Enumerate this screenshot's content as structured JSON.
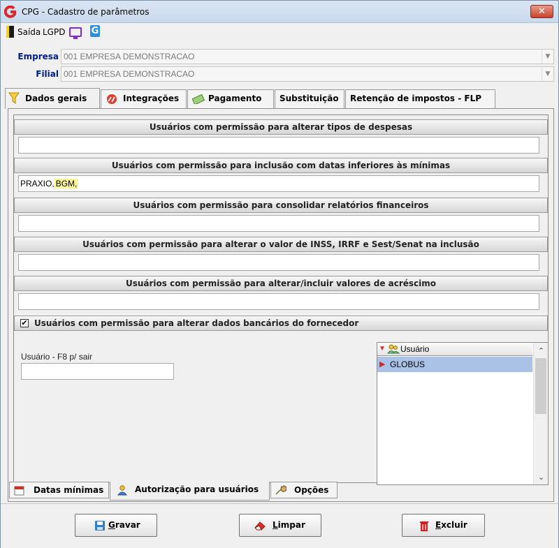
{
  "window": {
    "title": "CPG - Cadastro de parâmetros",
    "close_label": "✕"
  },
  "toolbar": {
    "exit_label": "Saída",
    "lgpd_label": "LGPD",
    "g_label": "G"
  },
  "fields": {
    "empresa_label": "Empresa",
    "empresa_value": "001 EMPRESA DEMONSTRACAO",
    "filial_label": "Filial",
    "filial_value": "001 EMPRESA DEMONSTRACAO"
  },
  "tabs": [
    {
      "label": "Dados gerais",
      "icon": "filter-icon"
    },
    {
      "label": "Integrações",
      "icon": "integration-icon"
    },
    {
      "label": "Pagamento",
      "icon": "money-icon"
    },
    {
      "label": "Substituição"
    },
    {
      "label": "Retenção de impostos - FLP"
    }
  ],
  "sections": [
    {
      "header": "Usuários com permissão para alterar tipos de despesas",
      "value": ""
    },
    {
      "header": "Usuários com permissão para inclusão com datas inferiores às mínimas",
      "value_plain": "PRAXIO,",
      "value_highlight": "BGM,"
    },
    {
      "header": "Usuários com permissão para consolidar relatórios financeiros",
      "value": ""
    },
    {
      "header": "Usuários com permissão para alterar o valor de INSS, IRRF e Sest/Senat na inclusão",
      "value": ""
    },
    {
      "header": "Usuários com permissão para alterar/incluir valores de acréscimo",
      "value": ""
    }
  ],
  "bank_section": {
    "checked": true,
    "check_mark": "✔",
    "label": "Usuários com permissão para alterar dados bancários do fornecedor",
    "user_input_label": "Usuário - F8 p/ sair",
    "user_input_value": "",
    "grid_header": "Usuário",
    "grid_rows": [
      "GLOBUS"
    ]
  },
  "bottom_tabs": [
    {
      "label": "Datas mínimas"
    },
    {
      "label": "Autorização para usuários"
    },
    {
      "label": "Opções"
    }
  ],
  "buttons": {
    "save_key": "G",
    "save_rest": "ravar",
    "clear_key": "L",
    "clear_rest": "impar",
    "delete_key": "E",
    "delete_rest": "xcluir"
  },
  "colors": {
    "label_blue": "#001c8c",
    "selection": "#a9c2e6",
    "highlight": "#fff59a"
  }
}
